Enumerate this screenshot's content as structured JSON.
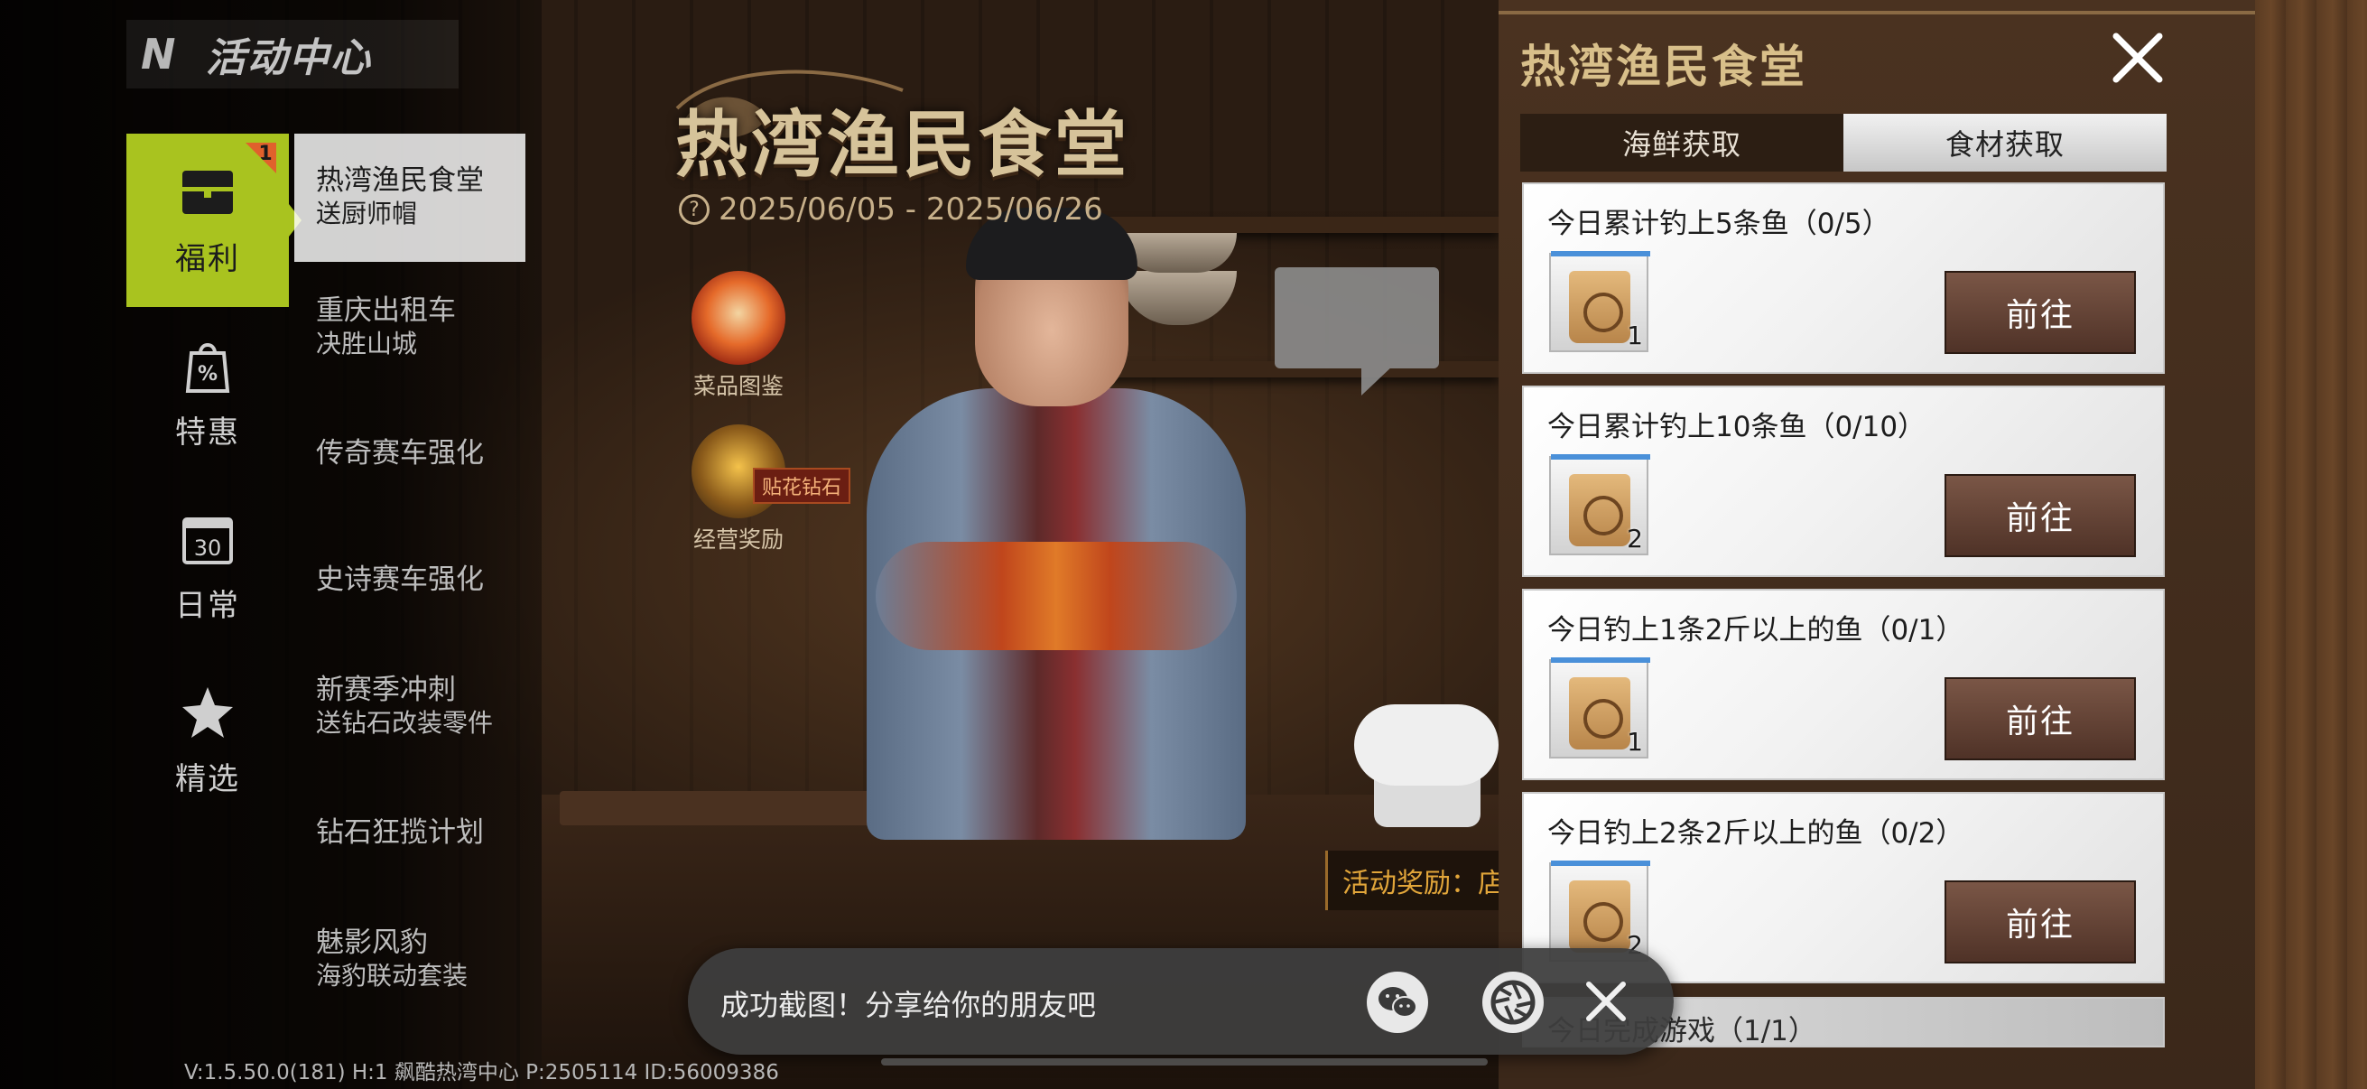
{
  "header": {
    "logo": "N",
    "title": "活动中心"
  },
  "categories": [
    {
      "label": "福利",
      "icon": "gift-box-icon",
      "badge": "1",
      "active": true
    },
    {
      "label": "特惠",
      "icon": "discount-bag-icon"
    },
    {
      "label": "日常",
      "icon": "calendar-icon",
      "icon_text": "30"
    },
    {
      "label": "精选",
      "icon": "star-icon"
    }
  ],
  "activities": [
    {
      "title": "热湾渔民食堂",
      "sub": "送厨师帽",
      "active": true
    },
    {
      "title": "重庆出租车",
      "sub": "决胜山城"
    },
    {
      "title": "传奇赛车强化",
      "sub": ""
    },
    {
      "title": "史诗赛车强化",
      "sub": ""
    },
    {
      "title": "新赛季冲刺",
      "sub": "送钻石改装零件"
    },
    {
      "title": "钻石狂揽计划",
      "sub": ""
    },
    {
      "title": "魅影风豹",
      "sub": "海豹联动套装"
    }
  ],
  "event": {
    "title": "热湾渔民食堂",
    "date_range": "2025/06/05 - 2025/06/26",
    "help_icon": "?",
    "dish_label": "菜品图鉴",
    "biz_label": "经营奖励",
    "biz_tag": "贴花钻石",
    "reward_strip": "活动奖励：店"
  },
  "panel": {
    "title": "热湾渔民食堂",
    "tabs": [
      {
        "label": "海鲜获取",
        "active": false
      },
      {
        "label": "食材获取",
        "active": true
      }
    ],
    "tasks": [
      {
        "title": "今日累计钓上5条鱼（0/5）",
        "item_count": "1",
        "button": "前往"
      },
      {
        "title": "今日累计钓上10条鱼（0/10）",
        "item_count": "2",
        "button": "前往"
      },
      {
        "title": "今日钓上1条2斤以上的鱼（0/1）",
        "item_count": "1",
        "button": "前往"
      },
      {
        "title": "今日钓上2条2斤以上的鱼（0/2）",
        "item_count": "2",
        "button": "前往"
      },
      {
        "title": "今日完成游戏（1/1）"
      }
    ]
  },
  "toast": {
    "message": "成功截图！分享给你的朋友吧",
    "share_icon": "wechat-icon",
    "shutter_icon": "camera-shutter-icon",
    "close_icon": "close-icon"
  },
  "footer": {
    "version": "V:1.5.50.0(181) H:1 飙酷热湾中心 P:2505114 ID:56009386"
  },
  "colors": {
    "accent_active": "#a9c31f",
    "badge": "#e0612c",
    "panel_title": "#d8bf8a",
    "go_button": "#5e3e31"
  }
}
